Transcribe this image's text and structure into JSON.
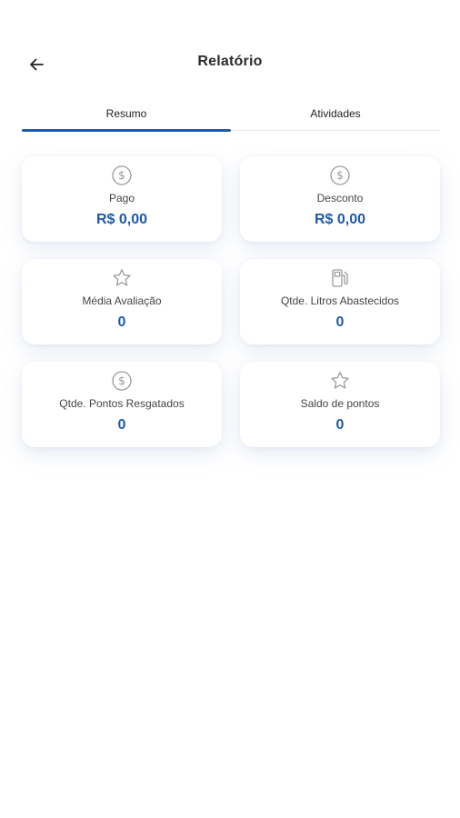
{
  "header": {
    "title": "Relatório",
    "back_icon": "arrow-left-icon"
  },
  "tabs": [
    {
      "label": "Resumo",
      "active": true
    },
    {
      "label": "Atividades",
      "active": false
    }
  ],
  "cards": [
    {
      "icon": "dollar-circle-icon",
      "label": "Pago",
      "value": "R$ 0,00"
    },
    {
      "icon": "dollar-circle-icon",
      "label": "Desconto",
      "value": "R$ 0,00"
    },
    {
      "icon": "star-icon",
      "label": "Média Avaliação",
      "value": "0"
    },
    {
      "icon": "fuel-pump-icon",
      "label": "Qtde. Litros Abastecidos",
      "value": "0"
    },
    {
      "icon": "dollar-circle-icon",
      "label": "Qtde. Pontos Resgatados",
      "value": "0"
    },
    {
      "icon": "star-icon",
      "label": "Saldo de pontos",
      "value": "0"
    }
  ],
  "colors": {
    "accent": "#1e5aa8",
    "icon_gray": "#9a9a9a"
  }
}
